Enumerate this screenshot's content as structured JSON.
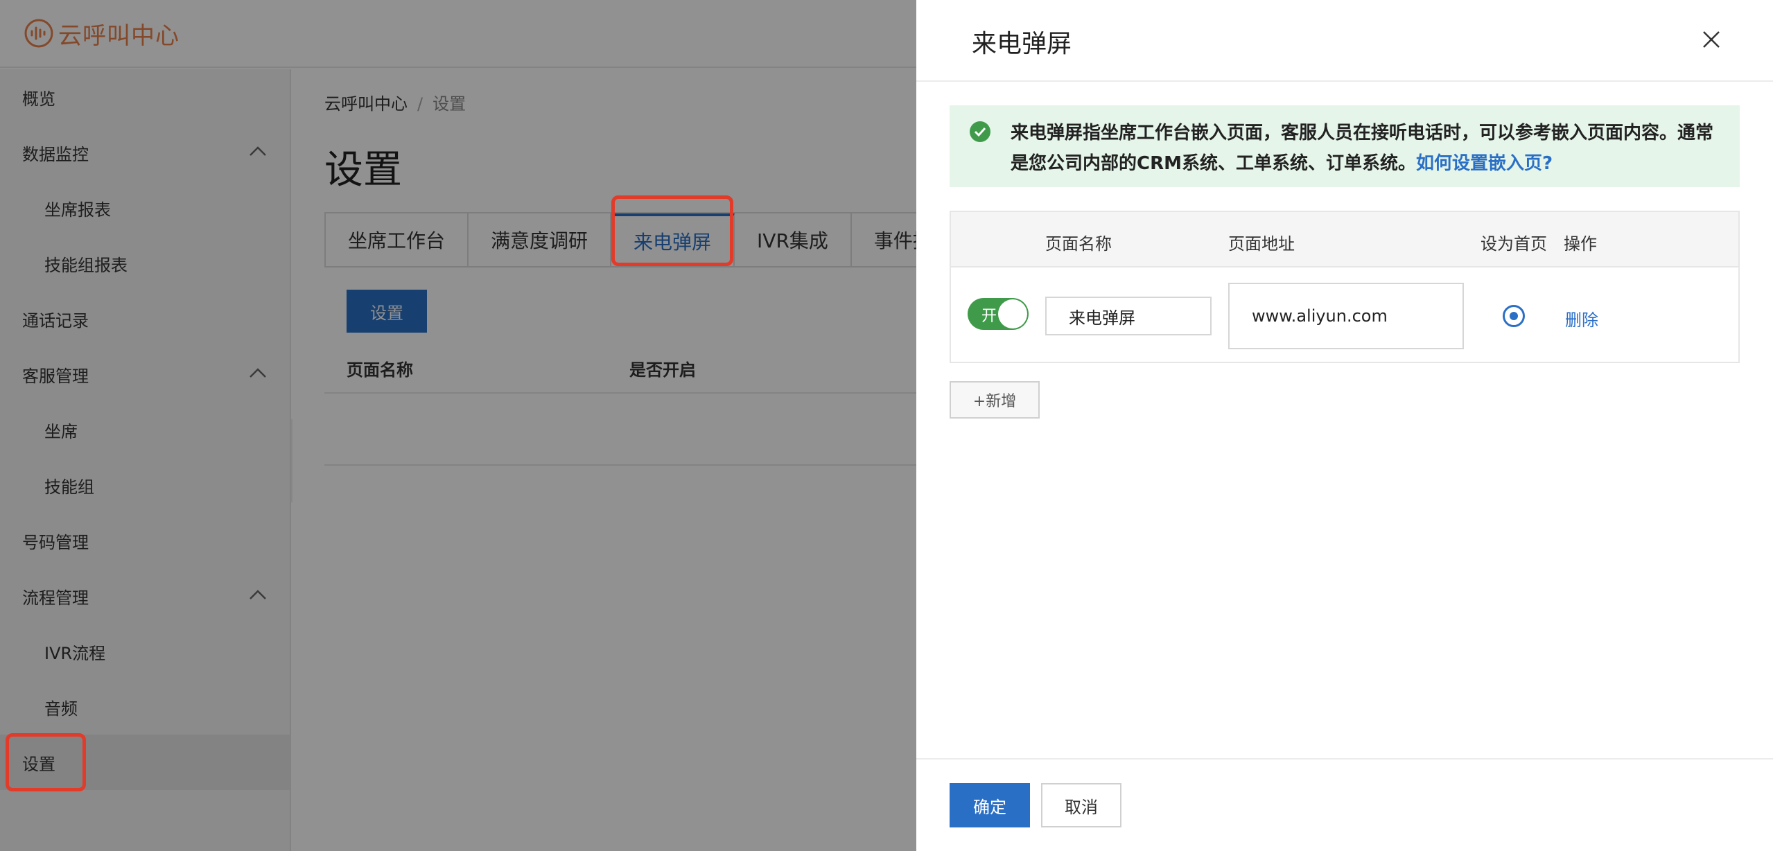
{
  "app": {
    "logo_text": "云呼叫中心"
  },
  "sidebar": {
    "items": [
      {
        "label": "概览",
        "level": "top"
      },
      {
        "label": "数据监控",
        "level": "top",
        "expanded": true
      },
      {
        "label": "坐席报表",
        "level": "sub"
      },
      {
        "label": "技能组报表",
        "level": "sub"
      },
      {
        "label": "通话记录",
        "level": "top"
      },
      {
        "label": "客服管理",
        "level": "top",
        "expanded": true
      },
      {
        "label": "坐席",
        "level": "sub"
      },
      {
        "label": "技能组",
        "level": "sub"
      },
      {
        "label": "号码管理",
        "level": "top"
      },
      {
        "label": "流程管理",
        "level": "top",
        "expanded": true
      },
      {
        "label": "IVR流程",
        "level": "sub"
      },
      {
        "label": "音频",
        "level": "sub"
      },
      {
        "label": "设置",
        "level": "top",
        "active": true
      }
    ]
  },
  "main": {
    "breadcrumb": [
      "云呼叫中心",
      "设置"
    ],
    "breadcrumb_separator": "/",
    "title": "设置",
    "tabs": [
      {
        "label": "坐席工作台"
      },
      {
        "label": "满意度调研"
      },
      {
        "label": "来电弹屏",
        "active": true
      },
      {
        "label": "IVR集成"
      },
      {
        "label": "事件推"
      }
    ],
    "setting_button": "设置",
    "list_columns": [
      "页面名称",
      "是否开启"
    ]
  },
  "drawer": {
    "title": "来电弹屏",
    "notice": {
      "text": "来电弹屏指坐席工作台嵌入页面，客服人员在接听电话时，可以参考嵌入页面内容。通常是您公司内部的CRM系统、工单系统、订单系统。",
      "link": "如何设置嵌入页?"
    },
    "table": {
      "columns": [
        "页面名称",
        "页面地址",
        "设为首页",
        "操作"
      ],
      "rows": [
        {
          "switch_label": "开",
          "enabled": true,
          "name": "来电弹屏",
          "url": "www.aliyun.com",
          "is_home": true,
          "action": "删除"
        }
      ]
    },
    "add_button": "+新增",
    "ok_button": "确定",
    "cancel_button": "取消"
  },
  "colors": {
    "primary": "#2a6fc6",
    "switch_on": "#3f9b49",
    "notice_bg": "#e5f5e9",
    "logo": "#e8804b",
    "highlight": "#e23b2a"
  },
  "icons": {
    "logo": "sound-wave-logo-icon",
    "chevron": "chevron-up-icon",
    "collapse": "chevron-left-icon",
    "close": "close-icon",
    "notice": "check-circle-icon"
  }
}
